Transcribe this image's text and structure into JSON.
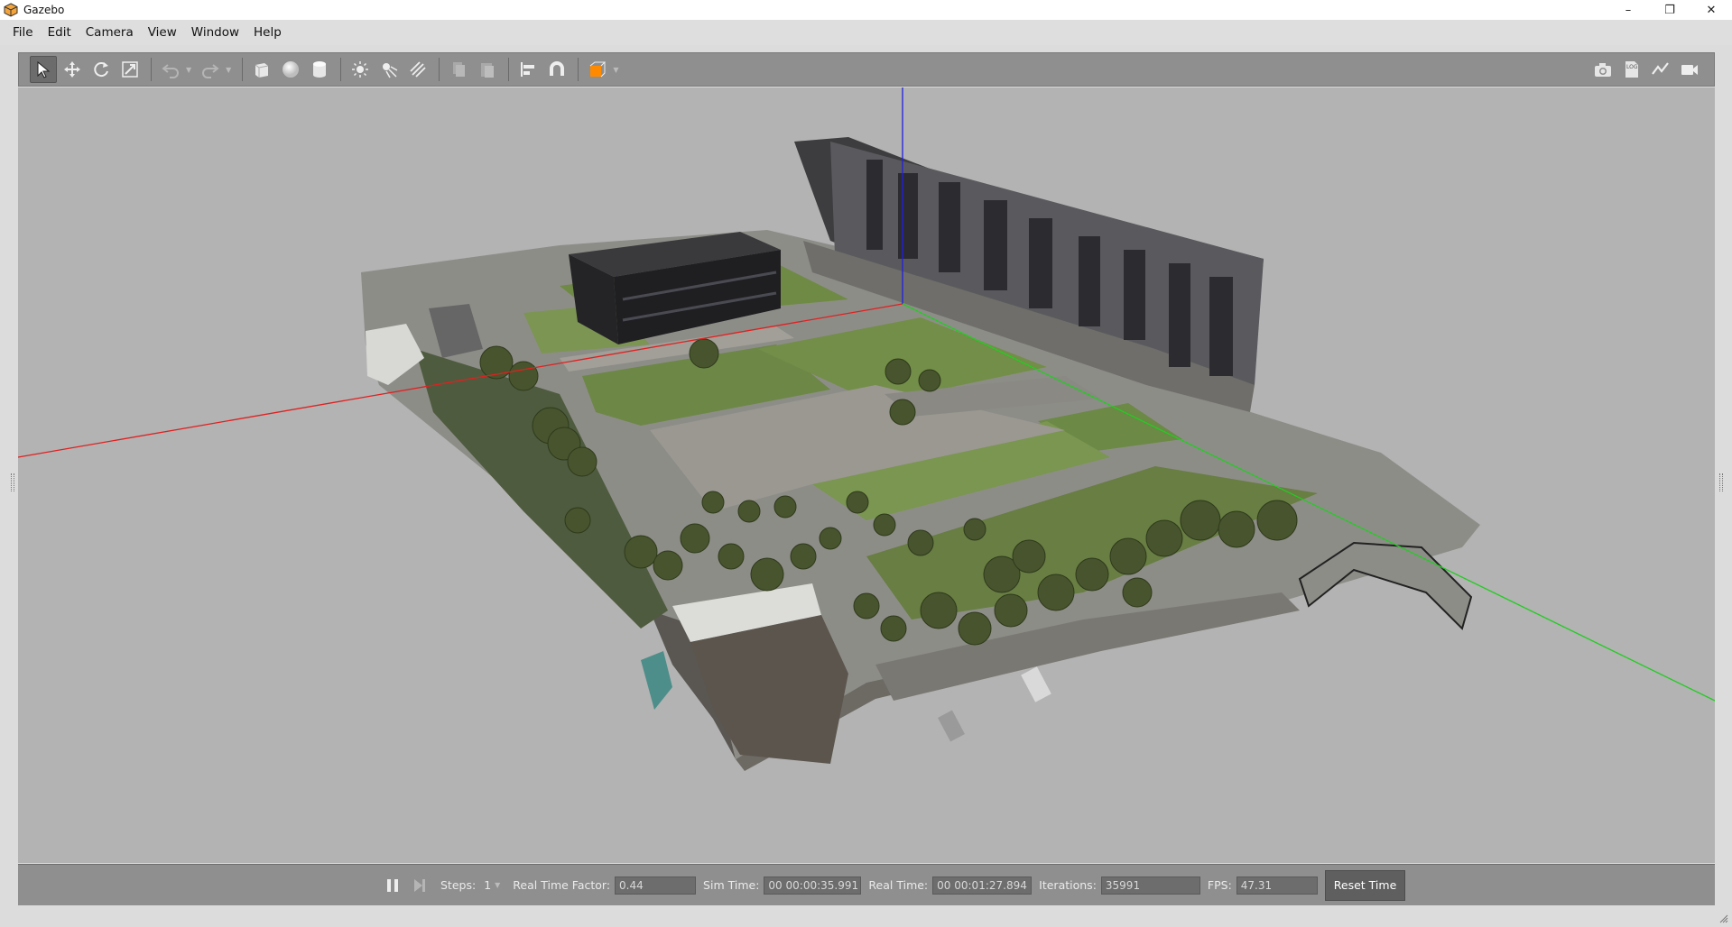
{
  "window": {
    "title": "Gazebo",
    "minimize": "–",
    "maximize": "❐",
    "close": "✕"
  },
  "menu": [
    {
      "label": "File"
    },
    {
      "label": "Edit"
    },
    {
      "label": "Camera"
    },
    {
      "label": "View"
    },
    {
      "label": "Window"
    },
    {
      "label": "Help"
    }
  ],
  "toolbar": {
    "left_icons": [
      "select-arrow-icon",
      "translate-icon",
      "rotate-icon",
      "scale-icon",
      "undo-icon",
      "redo-icon",
      "box-icon",
      "sphere-icon",
      "cylinder-icon",
      "point-light-icon",
      "spot-light-icon",
      "directional-light-icon",
      "copy-icon",
      "paste-icon",
      "align-icon",
      "snap-magnet-icon",
      "view-angle-icon"
    ],
    "right_icons": [
      "screenshot-icon",
      "log-icon",
      "plot-icon",
      "video-record-icon"
    ],
    "log_label": "LOG"
  },
  "bottom": {
    "steps_label": "Steps:",
    "steps_value": "1",
    "rtf_label": "Real Time Factor:",
    "rtf_value": "0.44",
    "sim_time_label": "Sim Time:",
    "sim_time_value": "00 00:00:35.991",
    "real_time_label": "Real Time:",
    "real_time_value": "00 00:01:27.894",
    "iterations_label": "Iterations:",
    "iterations_value": "35991",
    "fps_label": "FPS:",
    "fps_value": "47.31",
    "reset_label": "Reset Time"
  },
  "colors": {
    "x_axis": "#e02020",
    "y_axis": "#22cc22",
    "z_axis": "#2020e0",
    "accent": "#ff8a00"
  }
}
